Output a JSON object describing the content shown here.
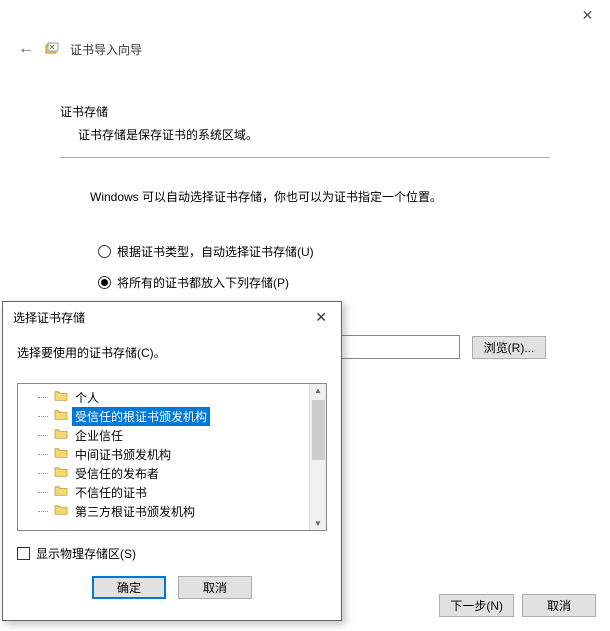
{
  "titlebar": {
    "close_glyph": "✕"
  },
  "header": {
    "back_glyph": "←",
    "title": "证书导入向导"
  },
  "main": {
    "section_title": "证书存储",
    "section_desc": "证书存储是保存证书的系统区域。",
    "instruction": "Windows 可以自动选择证书存储，你也可以为证书指定一个位置。",
    "radio_auto": "根据证书类型，自动选择证书存储(U)",
    "radio_manual": "将所有的证书都放入下列存储(P)",
    "selected_radio": "manual",
    "browse_label": "浏览(R)...",
    "next_label": "下一步(N)",
    "cancel_label": "取消"
  },
  "dialog": {
    "title": "选择证书存储",
    "close_glyph": "✕",
    "instruction": "选择要使用的证书存储(C)。",
    "tree_items": [
      {
        "label": "个人",
        "selected": false
      },
      {
        "label": "受信任的根证书颁发机构",
        "selected": true
      },
      {
        "label": "企业信任",
        "selected": false
      },
      {
        "label": "中间证书颁发机构",
        "selected": false
      },
      {
        "label": "受信任的发布者",
        "selected": false
      },
      {
        "label": "不信任的证书",
        "selected": false
      },
      {
        "label": "第三方根证书颁发机构",
        "selected": false
      }
    ],
    "show_physical_label": "显示物理存储区(S)",
    "ok_label": "确定",
    "cancel_label": "取消"
  }
}
